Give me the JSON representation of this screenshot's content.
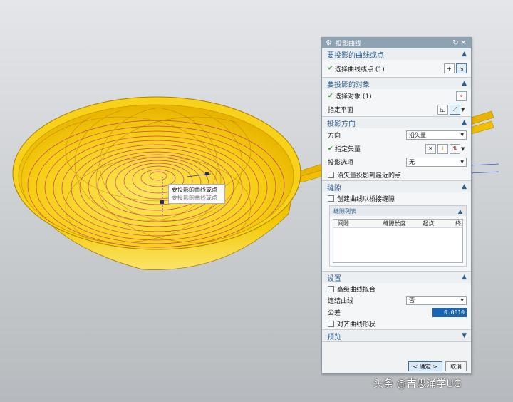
{
  "viewport": {
    "tooltip_line1": "要投影的曲线或点",
    "tooltip_line2": "要投影的曲线或点"
  },
  "dialog": {
    "title": "投影曲线",
    "sections": {
      "curves": {
        "header": "要投影的曲线或点",
        "select_label": "选择曲线或点 (1)"
      },
      "objects": {
        "header": "要投影的对象",
        "select_label": "选择对象 (1)",
        "plane_label": "指定平面"
      },
      "direction": {
        "header": "投影方向",
        "direction_label": "方向",
        "direction_value": "沿矢量",
        "vector_label": "指定矢量",
        "option_label": "投影选项",
        "option_value": "无",
        "nearest_label": "沿矢量投影到最近的点"
      },
      "gaps": {
        "header": "缝隙",
        "bridge_label": "创建曲线以桥接缝隙",
        "list_header": "缝隙列表",
        "columns": [
          "间隙",
          "缝隙长度",
          "起点",
          "终点"
        ]
      },
      "settings": {
        "header": "设置",
        "advanced_label": "高级曲线拟合",
        "join_label": "连结曲线",
        "join_value": "否",
        "tolerance_label": "公差",
        "tolerance_value": "0.0010",
        "align_label": "对齐曲线形状"
      },
      "preview": {
        "header": "预览"
      }
    },
    "ok_label": "< 确定 >",
    "cancel_label": "取消"
  },
  "watermark": "头条 @吉思涌学UG",
  "colors": {
    "accent": "#2f5e8c",
    "titlebar": "#8ea3b2",
    "model_yellow": "#f5c400",
    "curve_magenta": "#c0208c"
  }
}
